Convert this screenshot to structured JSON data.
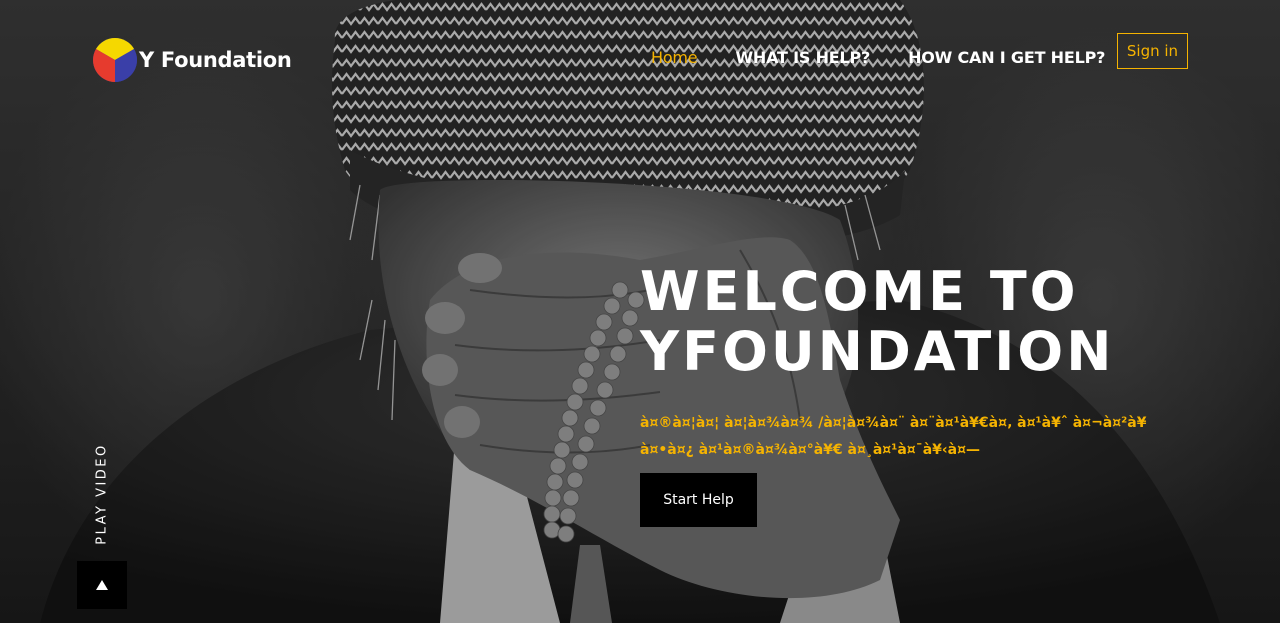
{
  "brand": {
    "name": "Y Foundation",
    "logo_colors": [
      "#f5d800",
      "#e63b2e",
      "#3a3fa8"
    ]
  },
  "nav": {
    "items": [
      {
        "label": "Home",
        "active": true
      },
      {
        "label": "WHAT IS HELP?",
        "active": false
      },
      {
        "label": "HOW CAN I GET HELP?",
        "active": false
      }
    ],
    "signin_label": "Sign in"
  },
  "hero": {
    "title_line1": "WELCOME TO",
    "title_line2": "YFOUNDATION",
    "subtitle": "à¤®à¤¦à¤¦ à¤¦à¤¾à¤¾ /à¤¦à¤¾à¤¨ à¤¨à¤¹à¥€à¤‚ à¤¹à¥ˆ à¤¬à¤²à¥ à¤•à¤¿ à¤¹à¤®à¤¾à¤°à¥€ à¤¸à¤¹à¤¯à¥‹à¤—",
    "cta_label": "Start Help",
    "image": "grayscale photo of an elderly man covering his face with his hand, wearing a patterned headscarf and holding prayer beads"
  },
  "video": {
    "label": "PLAY VIDEO",
    "icon": "play-icon"
  },
  "colors": {
    "accent": "#f5b301",
    "text": "#ffffff",
    "button_bg": "#000000"
  }
}
